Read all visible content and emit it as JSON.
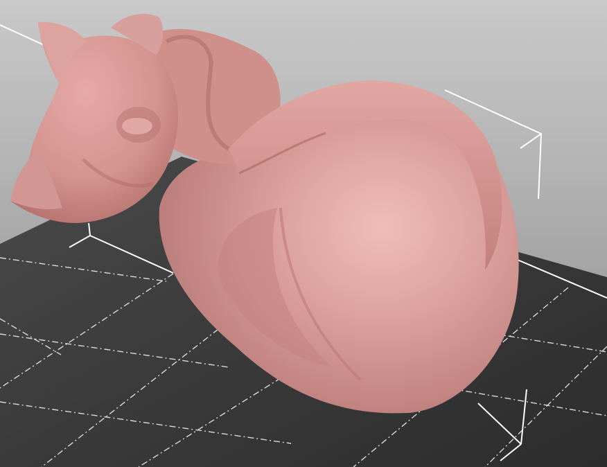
{
  "app": {
    "view": "3D print preview viewport",
    "model": {
      "icon": "cat-model-icon",
      "color": "#d89a96"
    },
    "bed": {
      "color": "#3a3a3a",
      "grid_color": "#ededed",
      "grid_style": "dash-dot"
    },
    "bounding_box": {
      "color": "#ffffff",
      "visible": true
    },
    "colors": {
      "background_top": "#c9c9c9",
      "background_bottom": "#8f8f8f",
      "model_shadow": "#b86f6c",
      "model_highlight": "#f0c0bc"
    }
  }
}
